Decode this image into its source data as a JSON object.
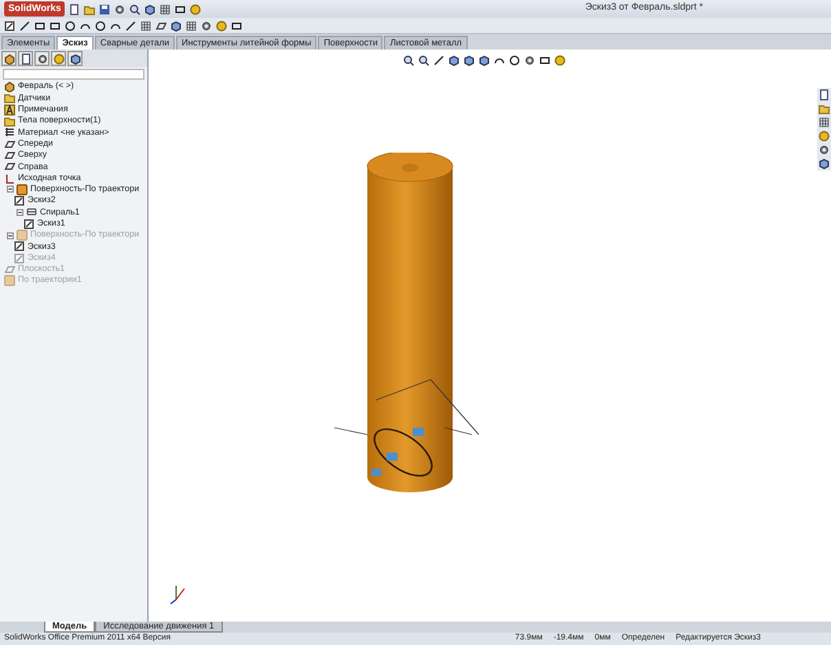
{
  "window": {
    "app_name": "SolidWorks",
    "title": "Эскиз3 от Февраль.sldprt *"
  },
  "command_tabs": [
    {
      "label": "Элементы",
      "selected": false
    },
    {
      "label": "Эскиз",
      "selected": true
    },
    {
      "label": "Сварные детали",
      "selected": false
    },
    {
      "label": "Инструменты литейной формы",
      "selected": false
    },
    {
      "label": "Поверхности",
      "selected": false
    },
    {
      "label": "Листовой металл",
      "selected": false
    }
  ],
  "feature_tree": {
    "items": [
      {
        "label": "Февраль  (< >)",
        "kind": "part",
        "suppressed": false
      },
      {
        "label": "Датчики",
        "kind": "folder",
        "suppressed": false
      },
      {
        "label": "Примечания",
        "kind": "annotation",
        "suppressed": false
      },
      {
        "label": "Тела поверхности(1)",
        "kind": "folder",
        "suppressed": false
      },
      {
        "label": "Материал <не указан>",
        "kind": "material",
        "suppressed": false
      },
      {
        "label": "Спереди",
        "kind": "plane",
        "suppressed": false
      },
      {
        "label": "Сверху",
        "kind": "plane",
        "suppressed": false
      },
      {
        "label": "Справа",
        "kind": "plane",
        "suppressed": false
      },
      {
        "label": "Исходная точка",
        "kind": "origin",
        "suppressed": false
      },
      {
        "label": "Поверхность-По траектори",
        "kind": "feature",
        "suppressed": false,
        "expanded": true,
        "children": [
          {
            "label": "Эскиз2",
            "kind": "sketch",
            "suppressed": false
          },
          {
            "label": "Спираль1",
            "kind": "helix",
            "suppressed": false,
            "expanded": true,
            "children": [
              {
                "label": "Эскиз1",
                "kind": "sketch",
                "suppressed": false
              }
            ]
          }
        ]
      },
      {
        "label": "Поверхность-По траектори",
        "kind": "feature",
        "suppressed": true,
        "expanded": true,
        "children": [
          {
            "label": "Эскиз3",
            "kind": "sketch",
            "suppressed": false
          },
          {
            "label": "Эскиз4",
            "kind": "sketch",
            "suppressed": true
          }
        ]
      },
      {
        "label": "Плоскость1",
        "kind": "plane",
        "suppressed": true
      },
      {
        "label": "По траектории1",
        "kind": "feature",
        "suppressed": true
      }
    ]
  },
  "bottom_tabs": [
    {
      "label": "Модель",
      "selected": true
    },
    {
      "label": "Исследование движения 1",
      "selected": false
    }
  ],
  "status_bar": {
    "product": "SolidWorks Office Premium 2011 x64 Версия",
    "x": "73.9мм",
    "y": "-19.4мм",
    "z": "0мм",
    "state": "Определен",
    "mode": "Редактируется Эскиз3"
  }
}
